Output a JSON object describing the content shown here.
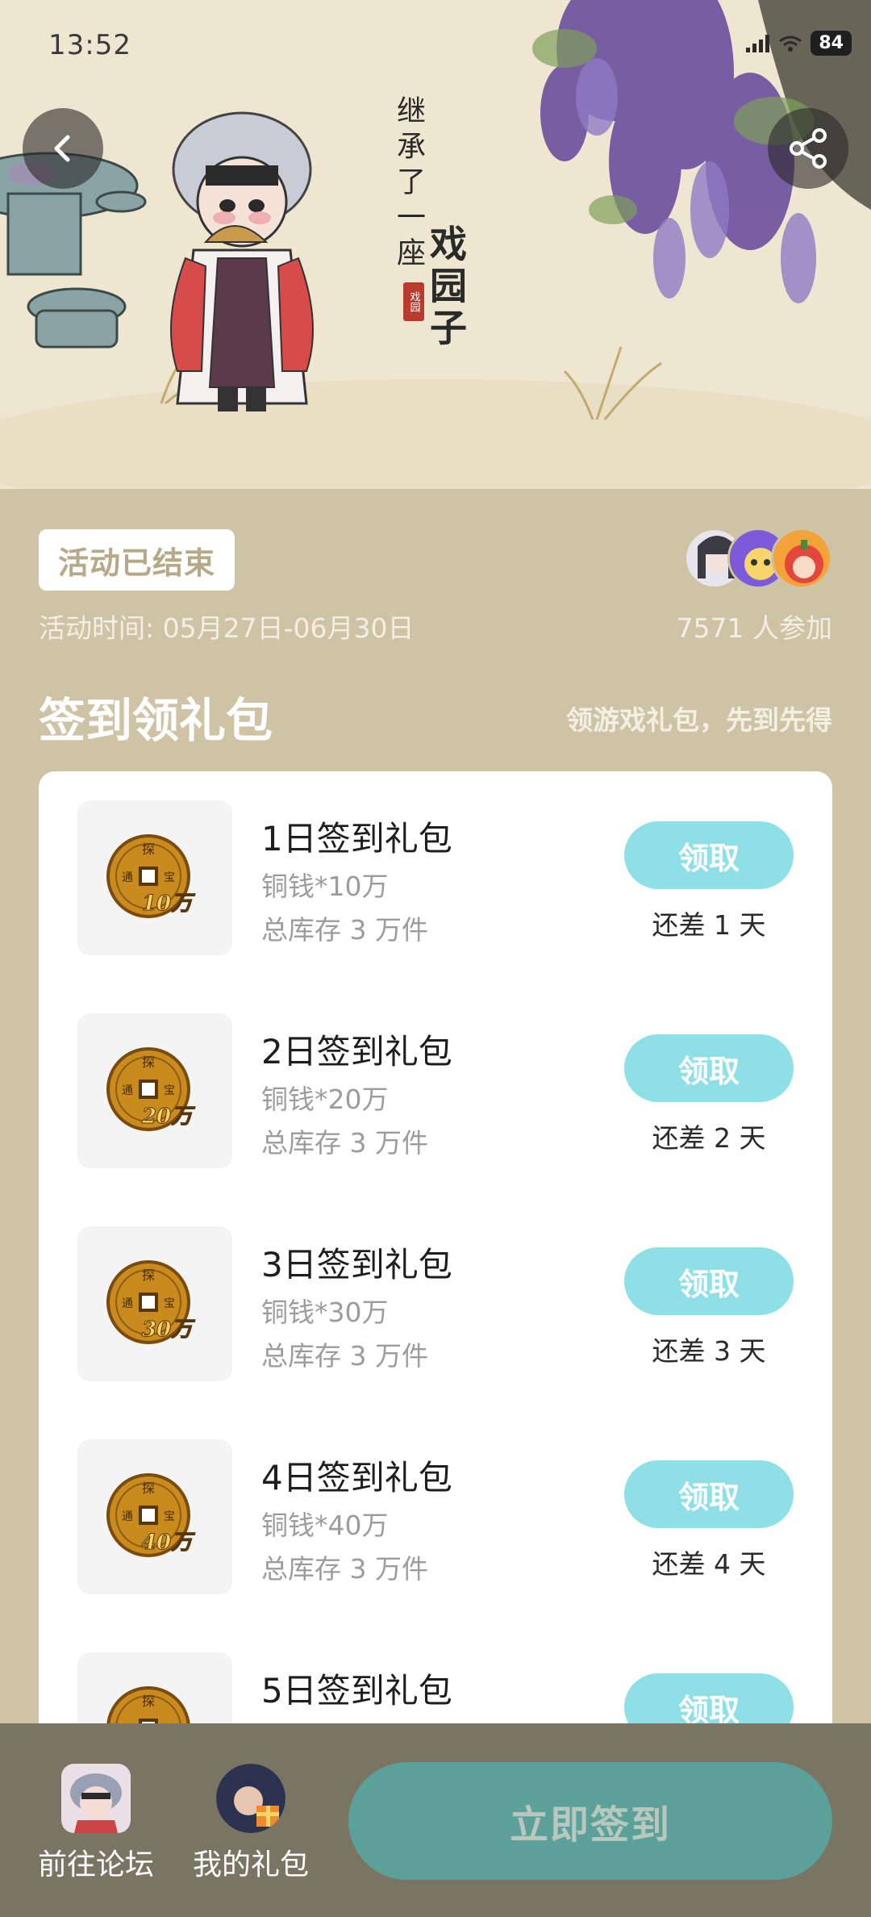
{
  "status_bar": {
    "time": "13:52",
    "battery": "84"
  },
  "hero": {
    "poem_line1": "继承了一座",
    "poem_line2": "戏园子",
    "seal_text": "戏园"
  },
  "activity": {
    "status": "活动已结束",
    "time_label": "活动时间: 05月27日-06月30日",
    "participants": "7571 人参加"
  },
  "section": {
    "title": "签到领礼包",
    "subtitle": "领游戏礼包，先到先得"
  },
  "gifts": [
    {
      "name": "1日签到礼包",
      "desc": "铜钱*10万",
      "stock": "总库存 3 万件",
      "button": "领取",
      "days_left": "还差 1 天",
      "coin_value": "10万"
    },
    {
      "name": "2日签到礼包",
      "desc": "铜钱*20万",
      "stock": "总库存 3 万件",
      "button": "领取",
      "days_left": "还差 2 天",
      "coin_value": "20万"
    },
    {
      "name": "3日签到礼包",
      "desc": "铜钱*30万",
      "stock": "总库存 3 万件",
      "button": "领取",
      "days_left": "还差 3 天",
      "coin_value": "30万"
    },
    {
      "name": "4日签到礼包",
      "desc": "铜钱*40万",
      "stock": "总库存 3 万件",
      "button": "领取",
      "days_left": "还差 4 天",
      "coin_value": "40万"
    },
    {
      "name": "5日签到礼包",
      "desc": "",
      "stock": "",
      "button": "领取",
      "days_left": "",
      "coin_value": ""
    }
  ],
  "coin_glyphs": {
    "top": "探",
    "left": "通",
    "right": "宝"
  },
  "bottom_bar": {
    "forum_label": "前往论坛",
    "my_gifts_label": "我的礼包",
    "signin_button": "立即签到"
  },
  "colors": {
    "page_bg": "#cfc3a6",
    "claim_button": "#8fe0e6",
    "signin_button": "#5ba19a",
    "bottom_bar": "#7a7463"
  },
  "icons": {
    "back": "back-chevron-icon",
    "share": "share-icon",
    "coin": "copper-coin-icon"
  }
}
